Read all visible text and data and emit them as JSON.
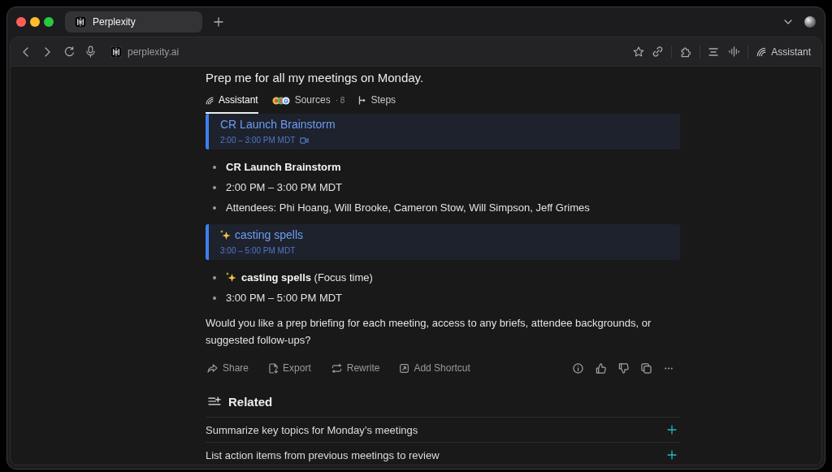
{
  "browser": {
    "tabs": [
      {
        "title": "Perplexity",
        "selected": true
      }
    ],
    "url": "perplexity.ai",
    "assistant_button": "Assistant"
  },
  "thread": {
    "query": "Prep me for all my meetings on Monday.",
    "answer_tabs": [
      {
        "kind": "assistant",
        "label": "Assistant",
        "selected": true
      },
      {
        "kind": "sources",
        "label": "Sources",
        "count": "· 8",
        "selected": false
      },
      {
        "kind": "steps",
        "label": "Steps",
        "selected": false
      }
    ],
    "blocks": [
      {
        "kind": "event",
        "title": "CR Launch Brainstorm",
        "time": "2:00 – 3:00 PM MDT",
        "emoji": false,
        "video": true
      },
      {
        "kind": "list",
        "items": [
          {
            "kind": "heading",
            "text": "CR Launch Brainstorm",
            "emoji": false
          },
          {
            "kind": "plain",
            "text": "2:00 PM – 3:00 PM MDT",
            "emoji": false
          },
          {
            "kind": "plain",
            "text": "Attendees: Phi Hoang, Will Brooke, Cameron Stow, Will Simpson, Jeff Grimes",
            "emoji": false
          }
        ]
      },
      {
        "kind": "event",
        "title": "casting spells",
        "time": "3:00 – 5:00 PM MDT",
        "emoji": true,
        "video": false
      },
      {
        "kind": "list",
        "items": [
          {
            "kind": "plain",
            "text": "**casting spells** (Focus time)",
            "emoji": true
          },
          {
            "kind": "plain",
            "text": "3:00 PM – 5:00 PM MDT",
            "emoji": false
          }
        ]
      },
      {
        "kind": "paragraph",
        "text": "Would you like a prep briefing for each meeting, access to any briefs, attendee backgrounds, or suggested follow-ups?"
      }
    ],
    "actions": [
      {
        "kind": "share",
        "label": "Share"
      },
      {
        "kind": "export",
        "label": "Export"
      },
      {
        "kind": "rewrite",
        "label": "Rewrite"
      },
      {
        "kind": "shortcut",
        "label": "Add Shortcut"
      }
    ],
    "related": {
      "title": "Related",
      "items": [
        "Summarize key topics for Monday’s meetings",
        "List action items from previous meetings to review"
      ]
    }
  }
}
